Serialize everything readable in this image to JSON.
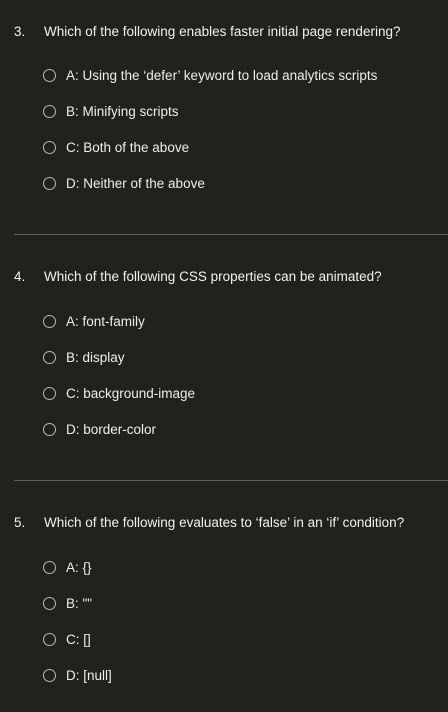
{
  "questions": [
    {
      "number": "3.",
      "text": "Which of the following enables faster initial page rendering?",
      "options": [
        "A: Using the ‘defer’ keyword to load analytics scripts",
        "B: Minifying scripts",
        "C: Both of the above",
        "D: Neither of the above"
      ]
    },
    {
      "number": "4.",
      "text": "Which of the following CSS properties can be animated?",
      "options": [
        "A: font-family",
        "B: display",
        "C: background-image",
        "D: border-color"
      ]
    },
    {
      "number": "5.",
      "text": "Which of the following evaluates to ‘false’ in an ‘if’ condition?",
      "options": [
        "A: {}",
        "B: \"\"",
        "C: []",
        "D: [null]"
      ]
    }
  ]
}
